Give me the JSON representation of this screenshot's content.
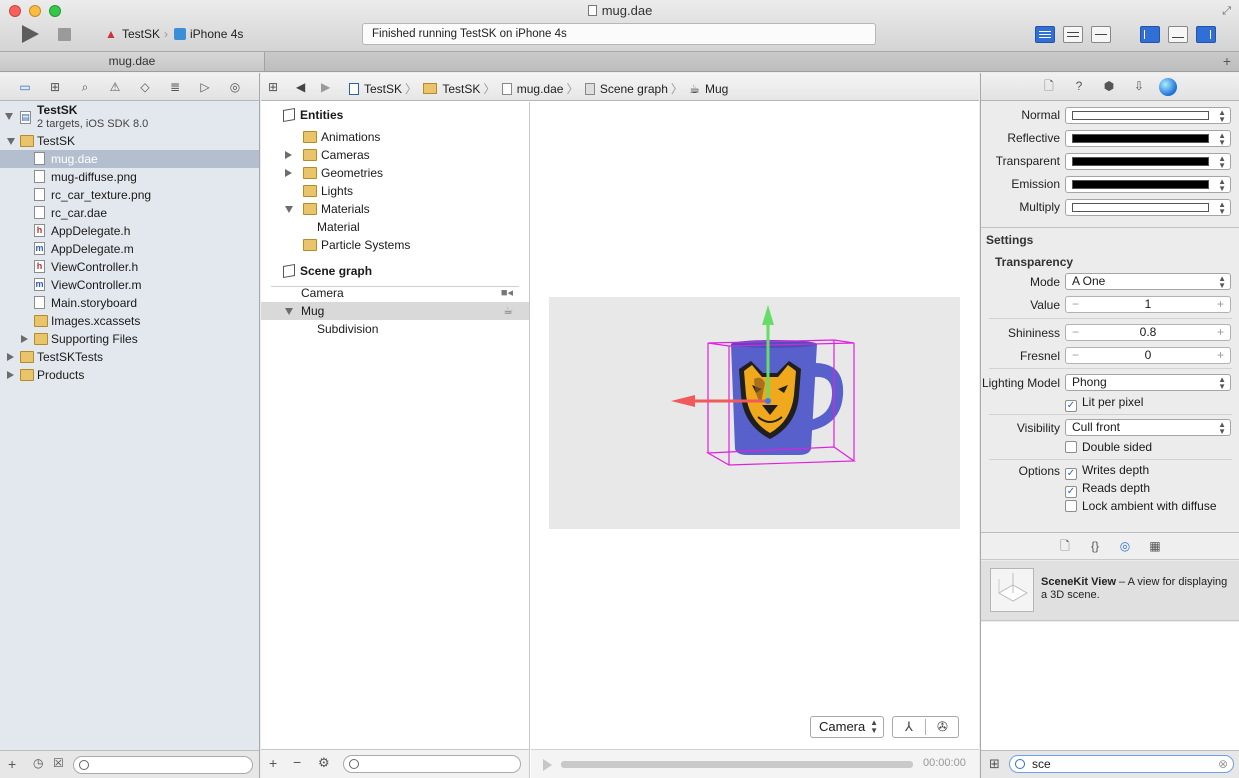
{
  "window": {
    "title": "mug.dae",
    "status": "Finished running TestSK on iPhone 4s",
    "scheme": "TestSK",
    "device": "iPhone 4s",
    "tab": "mug.dae"
  },
  "navigator": {
    "project": {
      "name": "TestSK",
      "subtitle": "2 targets, iOS SDK 8.0"
    },
    "items": [
      {
        "label": "TestSK",
        "icon": "folder-icon",
        "level": 1,
        "disclosure": "open"
      },
      {
        "label": "mug.dae",
        "icon": "file-icon",
        "level": 2,
        "selected": true
      },
      {
        "label": "mug-diffuse.png",
        "icon": "file-icon",
        "level": 2
      },
      {
        "label": "rc_car_texture.png",
        "icon": "file-icon",
        "level": 2
      },
      {
        "label": "rc_car.dae",
        "icon": "file-icon",
        "level": 2
      },
      {
        "label": "AppDelegate.h",
        "icon": "header-file-icon",
        "level": 2
      },
      {
        "label": "AppDelegate.m",
        "icon": "source-file-icon",
        "level": 2
      },
      {
        "label": "ViewController.h",
        "icon": "header-file-icon",
        "level": 2
      },
      {
        "label": "ViewController.m",
        "icon": "source-file-icon",
        "level": 2
      },
      {
        "label": "Main.storyboard",
        "icon": "file-icon",
        "level": 2
      },
      {
        "label": "Images.xcassets",
        "icon": "folder-icon",
        "level": 2
      },
      {
        "label": "Supporting Files",
        "icon": "folder-icon",
        "level": 2,
        "disclosure": "closed"
      },
      {
        "label": "TestSKTests",
        "icon": "folder-icon",
        "level": 1,
        "disclosure": "closed"
      },
      {
        "label": "Products",
        "icon": "folder-icon",
        "level": 1,
        "disclosure": "closed"
      }
    ]
  },
  "jumpbar": {
    "crumbs": [
      "TestSK",
      "TestSK",
      "mug.dae",
      "Scene graph",
      "Mug"
    ]
  },
  "outline": {
    "entities_header": "Entities",
    "entities": [
      {
        "label": "Animations",
        "disclosure": "none"
      },
      {
        "label": "Cameras",
        "disclosure": "closed"
      },
      {
        "label": "Geometries",
        "disclosure": "closed"
      },
      {
        "label": "Lights",
        "disclosure": "none"
      },
      {
        "label": "Materials",
        "disclosure": "open"
      },
      {
        "label": "Material",
        "child": true
      },
      {
        "label": "Particle Systems",
        "disclosure": "none"
      }
    ],
    "scenegraph_header": "Scene graph",
    "scenegraph": [
      {
        "label": "Camera",
        "icon": "video-camera-icon"
      },
      {
        "label": "Mug",
        "icon": "teapot-icon",
        "selected": true,
        "disclosure": "open"
      },
      {
        "label": "Subdivision",
        "child": true
      }
    ]
  },
  "viewport": {
    "camera_select": "Camera",
    "time": "00:00:00"
  },
  "inspector": {
    "colors": [
      {
        "label": "Normal",
        "swatch": "#ffffff"
      },
      {
        "label": "Reflective",
        "swatch": "#000000"
      },
      {
        "label": "Transparent",
        "swatch": "#000000"
      },
      {
        "label": "Emission",
        "swatch": "#000000"
      },
      {
        "label": "Multiply",
        "swatch": "#ffffff"
      }
    ],
    "settings_title": "Settings",
    "transparency_title": "Transparency",
    "mode_label": "Mode",
    "mode_value": "A One",
    "value_label": "Value",
    "value": "1",
    "shininess_label": "Shininess",
    "shininess": "0.8",
    "fresnel_label": "Fresnel",
    "fresnel": "0",
    "lighting_label": "Lighting Model",
    "lighting_value": "Phong",
    "lit_per_pixel": {
      "label": "Lit per pixel",
      "checked": true
    },
    "visibility_label": "Visibility",
    "visibility_value": "Cull front",
    "double_sided": {
      "label": "Double sided",
      "checked": false
    },
    "options_label": "Options",
    "writes_depth": {
      "label": "Writes depth",
      "checked": true
    },
    "reads_depth": {
      "label": "Reads depth",
      "checked": true
    },
    "lock_ambient": {
      "label": "Lock ambient with diffuse",
      "checked": false
    },
    "library": {
      "title": "SceneKit View",
      "description": " – A view for displaying a 3D scene."
    },
    "filter_value": "sce"
  }
}
